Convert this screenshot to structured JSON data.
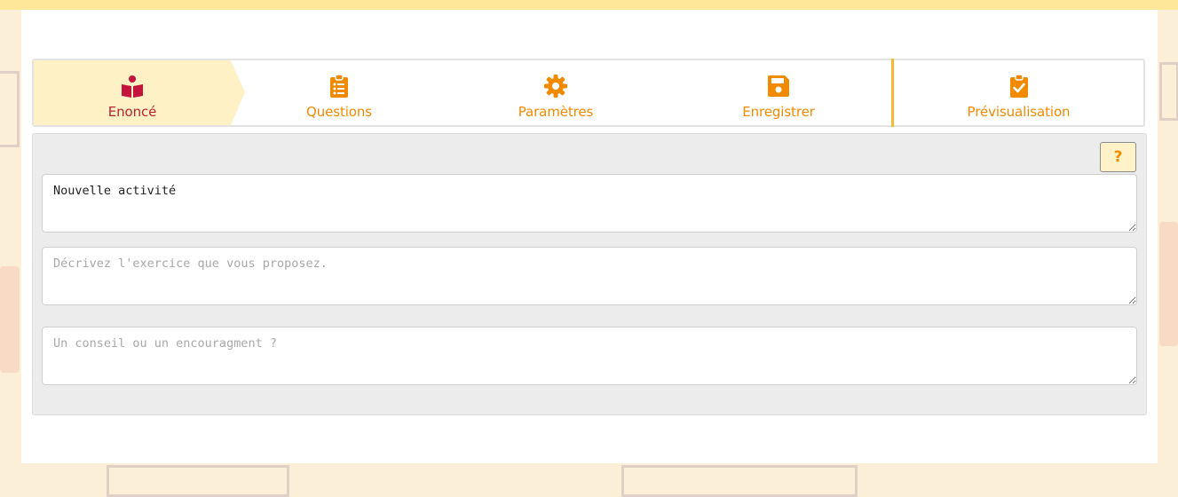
{
  "stepper": {
    "steps": [
      {
        "label": "Enoncé",
        "icon": "book-reader-icon",
        "active": true
      },
      {
        "label": "Questions",
        "icon": "clipboard-list-icon",
        "active": false
      },
      {
        "label": "Paramètres",
        "icon": "gear-icon",
        "active": false
      },
      {
        "label": "Enregistrer",
        "icon": "save-icon",
        "active": false
      },
      {
        "label": "Prévisualisation",
        "icon": "clipboard-check-icon",
        "active": false
      }
    ]
  },
  "help": {
    "label": "?"
  },
  "form": {
    "title": {
      "value": "Nouvelle activité",
      "placeholder": ""
    },
    "description": {
      "value": "",
      "placeholder": "Décrivez l'exercice que vous proposez."
    },
    "tip": {
      "value": "",
      "placeholder": "Un conseil ou un encouragment ?"
    }
  },
  "colors": {
    "accent": "#f28a00",
    "active_label": "#b8242f",
    "active_bg": "#fff1c6",
    "divider": "#f7b932",
    "form_bg": "#ececec"
  }
}
